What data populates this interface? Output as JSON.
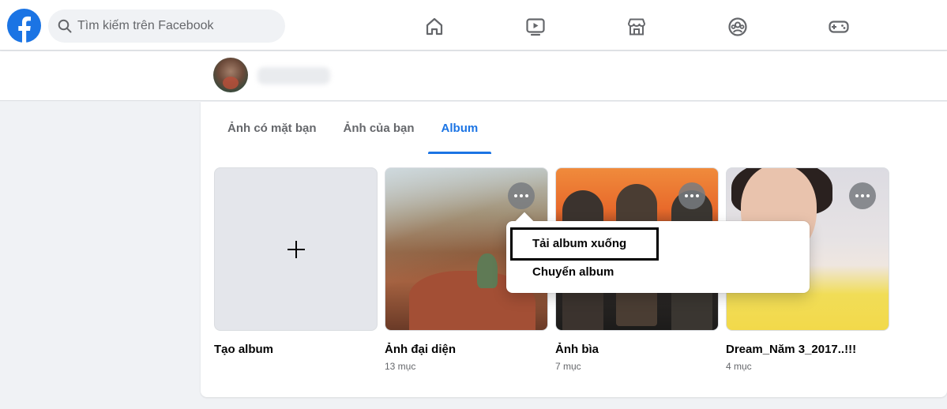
{
  "app": "Facebook",
  "colors": {
    "brand": "#1b74e4",
    "icon": "#65676b"
  },
  "header": {
    "search": {
      "placeholder": "Tìm kiếm trên Facebook"
    },
    "nav_icons": [
      "home-icon",
      "watch-icon",
      "marketplace-icon",
      "groups-icon",
      "gaming-icon"
    ]
  },
  "tabs": [
    {
      "label": "Ảnh có mặt bạn",
      "active": false
    },
    {
      "label": "Ảnh của bạn",
      "active": false
    },
    {
      "label": "Album",
      "active": true
    }
  ],
  "albums": [
    {
      "title": "Tạo album",
      "count": ""
    },
    {
      "title": "Ảnh đại diện",
      "count": "13 mục"
    },
    {
      "title": "Ảnh bìa",
      "count": "7 mục"
    },
    {
      "title": "Dream_Năm 3_2017..!!!",
      "count": "4 mục"
    }
  ],
  "context_menu": {
    "items": [
      "Tải album xuống",
      "Chuyển album"
    ]
  }
}
